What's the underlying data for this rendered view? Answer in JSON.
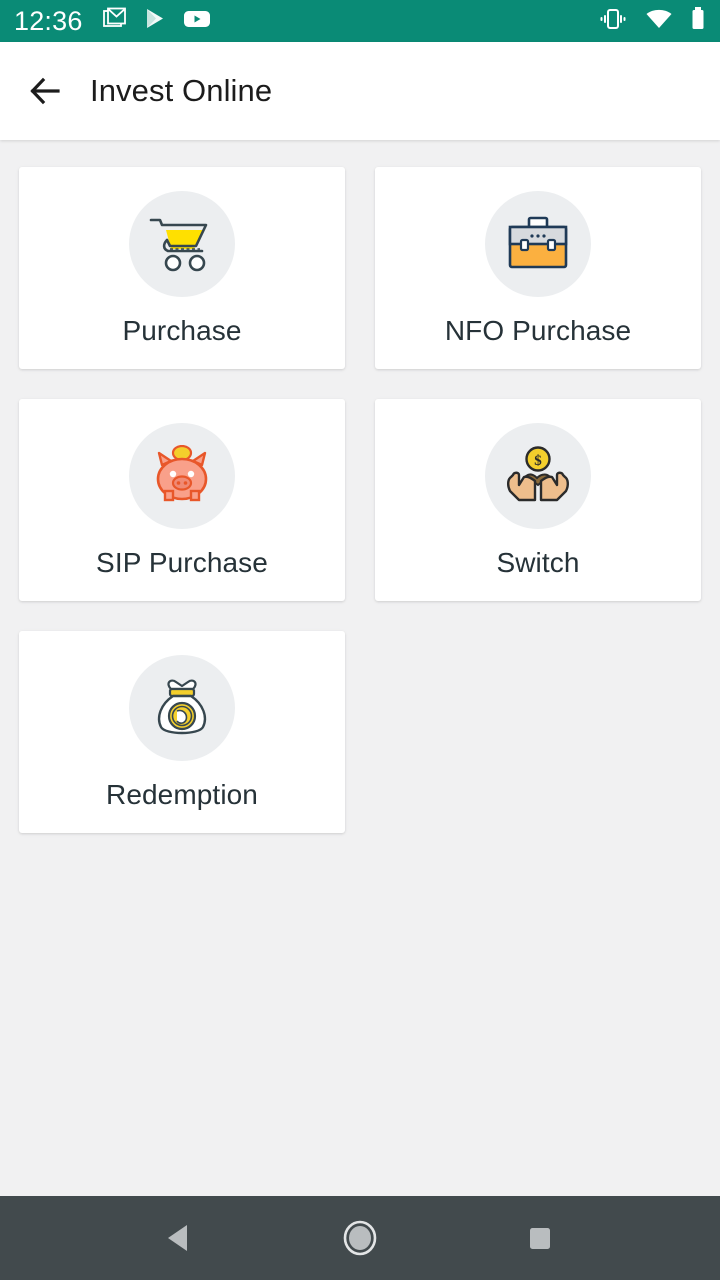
{
  "status_bar": {
    "time": "12:36",
    "background_color": "#0a8b76",
    "left_icons": [
      {
        "name": "gmail-icon",
        "label": "Gmail"
      },
      {
        "name": "play-store-icon",
        "label": "Google Play"
      },
      {
        "name": "youtube-icon",
        "label": "YouTube"
      }
    ],
    "right_icons": [
      {
        "name": "vibrate-icon",
        "label": "Vibrate"
      },
      {
        "name": "wifi-icon",
        "label": "Wi-Fi"
      },
      {
        "name": "battery-icon",
        "label": "Battery"
      }
    ]
  },
  "app_bar": {
    "title": "Invest Online",
    "back_label": "Back",
    "background_color": "#ffffff",
    "title_color": "#1c1c1c"
  },
  "page": {
    "background_color": "#f1f1f2",
    "card_background_color": "#ffffff",
    "icon_circle_color": "#eceef0",
    "label_color": "#263238"
  },
  "grid": {
    "items": [
      {
        "label": "Purchase",
        "icon": "shopping-cart-icon"
      },
      {
        "label": "NFO Purchase",
        "icon": "briefcase-icon"
      },
      {
        "label": "SIP Purchase",
        "icon": "piggy-bank-icon"
      },
      {
        "label": "Switch",
        "icon": "hands-with-coin-icon"
      },
      {
        "label": "Redemption",
        "icon": "money-bag-icon"
      }
    ]
  },
  "nav_bar": {
    "background_color": "#424a4d",
    "buttons": [
      {
        "name": "nav-back-button",
        "label": "Back"
      },
      {
        "name": "nav-home-button",
        "label": "Home"
      },
      {
        "name": "nav-recents-button",
        "label": "Recents"
      }
    ]
  }
}
